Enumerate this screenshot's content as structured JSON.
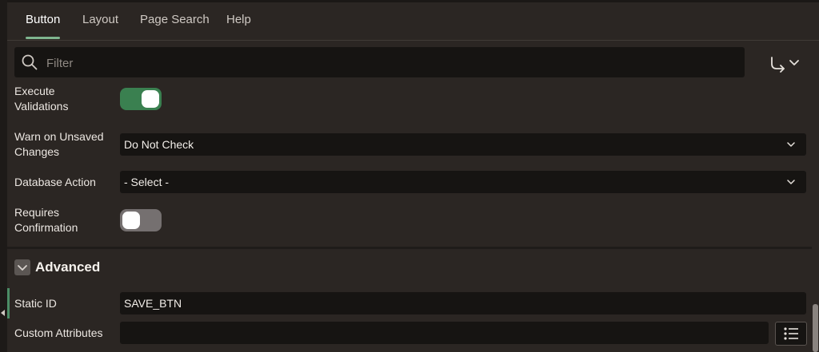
{
  "tabs": [
    {
      "label": "Button",
      "active": true
    },
    {
      "label": "Layout",
      "active": false
    },
    {
      "label": "Page Search",
      "active": false
    },
    {
      "label": "Help",
      "active": false
    }
  ],
  "filter": {
    "placeholder": "Filter",
    "value": ""
  },
  "properties": {
    "execute_validations": {
      "label_line1": "Execute",
      "label_line2": "Validations",
      "enabled": true
    },
    "warn_unsaved": {
      "label_line1": "Warn on Unsaved",
      "label_line2": "Changes",
      "value": "Do Not Check"
    },
    "database_action": {
      "label": "Database Action",
      "value": "- Select -"
    },
    "requires_confirmation": {
      "label_line1": "Requires",
      "label_line2": "Confirmation",
      "enabled": false
    }
  },
  "advanced": {
    "title": "Advanced",
    "static_id": {
      "label": "Static ID",
      "value": "SAVE_BTN"
    },
    "custom_attributes": {
      "label": "Custom Attributes",
      "value": ""
    }
  },
  "colors": {
    "accent": "#7fb58f",
    "toggle_on": "#3a8050",
    "background": "#2b2623",
    "field": "#161412"
  },
  "icons": [
    "search-icon",
    "goto-arrow-icon",
    "chevron-down-icon",
    "collapse-section-icon",
    "list-icon"
  ]
}
